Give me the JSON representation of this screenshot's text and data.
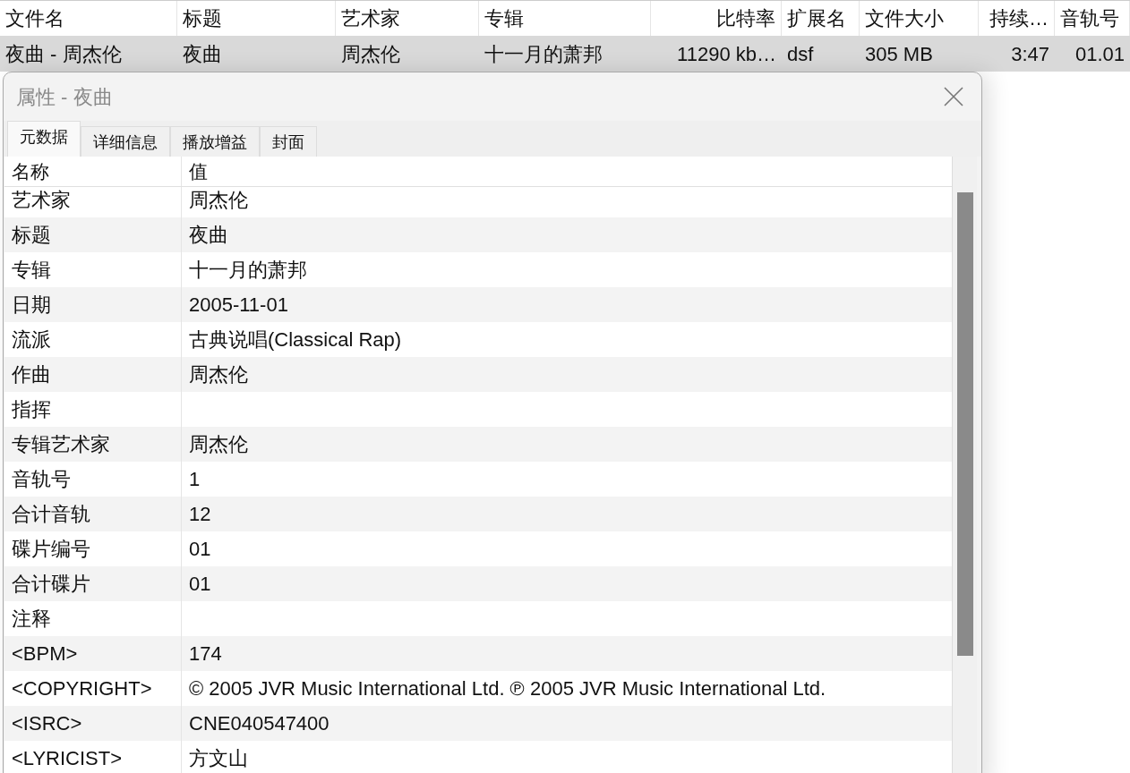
{
  "file_table": {
    "columns": [
      "文件名",
      "标题",
      "艺术家",
      "专辑",
      "比特率",
      "扩展名",
      "文件大小",
      "持续…",
      "音轨号"
    ],
    "rows": [
      {
        "selected": true,
        "cells": [
          "夜曲 - 周杰伦",
          "夜曲",
          "周杰伦",
          "十一月的萧邦",
          "11290 kb…",
          "dsf",
          "305 MB",
          "3:47",
          "01.01"
        ]
      }
    ]
  },
  "dialog": {
    "title": "属性 - 夜曲",
    "tabs": [
      {
        "label": "元数据",
        "selected": true
      },
      {
        "label": "详细信息",
        "selected": false
      },
      {
        "label": "播放增益",
        "selected": false
      },
      {
        "label": "封面",
        "selected": false
      }
    ],
    "list": {
      "columns": [
        "名称",
        "值"
      ],
      "rows": [
        {
          "name": "艺术家",
          "value": "周杰伦"
        },
        {
          "name": "标题",
          "value": "夜曲"
        },
        {
          "name": "专辑",
          "value": "十一月的萧邦"
        },
        {
          "name": "日期",
          "value": "2005-11-01"
        },
        {
          "name": "流派",
          "value": "古典说唱(Classical Rap)"
        },
        {
          "name": "作曲",
          "value": "周杰伦"
        },
        {
          "name": "指挥"
        },
        {
          "name": "专辑艺术家",
          "value": "周杰伦"
        },
        {
          "name": "音轨号",
          "value": "1"
        },
        {
          "name": "合计音轨",
          "value": "12"
        },
        {
          "name": "碟片编号",
          "value": "01"
        },
        {
          "name": "合计碟片",
          "value": "01"
        },
        {
          "name": "注释"
        },
        {
          "name": "<BPM>",
          "value": "174"
        },
        {
          "name": "<COPYRIGHT>",
          "value": "© 2005 JVR Music International Ltd. ℗ 2005 JVR Music International Ltd."
        },
        {
          "name": "<ISRC>",
          "value": "CNE040547400"
        },
        {
          "name": "<LYRICIST>",
          "value": "方文山"
        }
      ]
    }
  }
}
